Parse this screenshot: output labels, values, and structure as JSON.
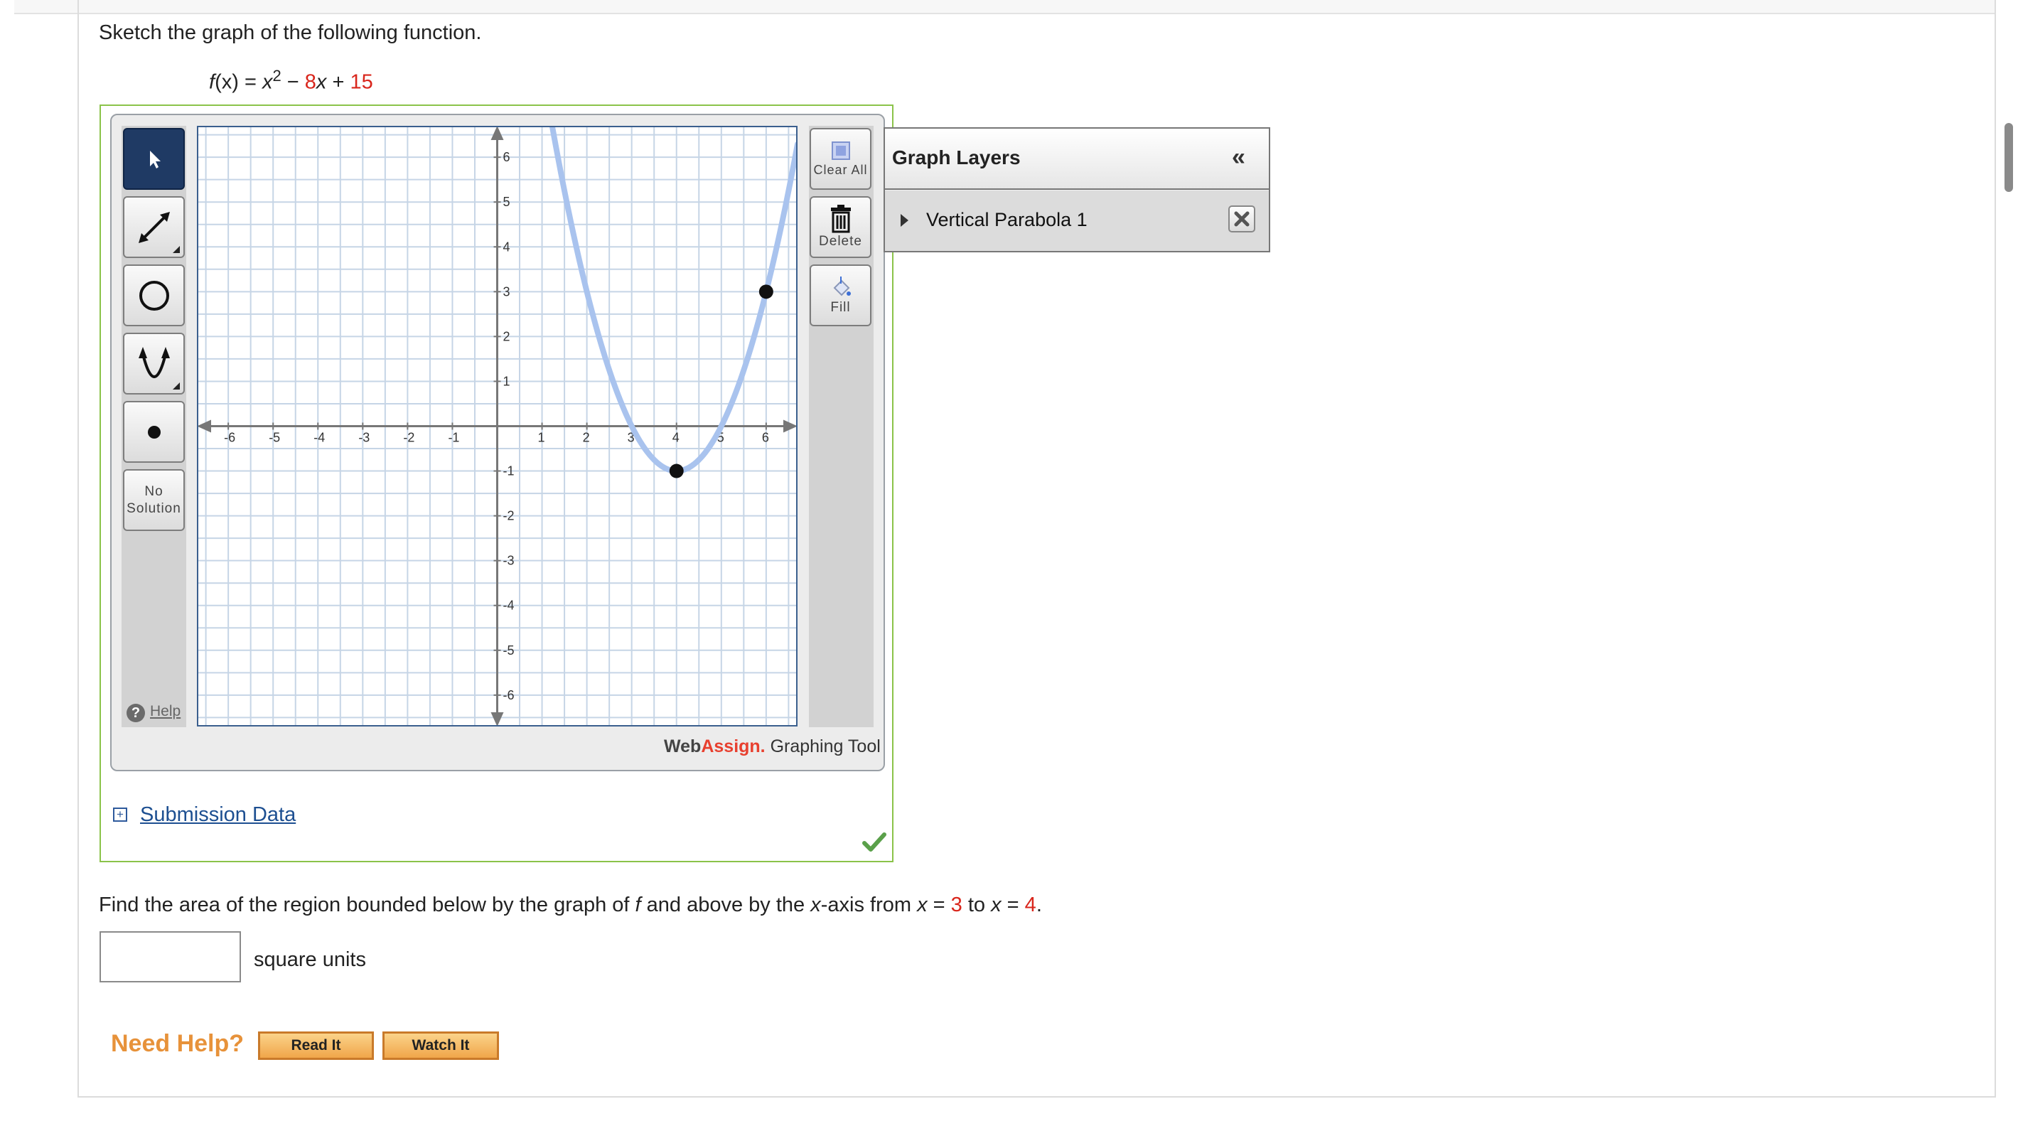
{
  "question": {
    "prompt": "Sketch the graph of the following function.",
    "function": {
      "lhs": "f",
      "lhs_arg": "(x)",
      "eq": " = ",
      "x": "x",
      "exp": "2",
      "minus": " − ",
      "b": "8",
      "bx": "x",
      "plus": " + ",
      "c": "15"
    },
    "part2": {
      "t1": "Find the area of the region bounded below by the graph of ",
      "f": "f",
      "t2": " and above by the ",
      "x1": "x",
      "t3": "-axis from ",
      "x2": "x",
      "t4": " = ",
      "a": "3",
      "t5": " to ",
      "x3": "x",
      "t6": " = ",
      "b": "4",
      "t7": "."
    },
    "answer_value": "",
    "units": "square units"
  },
  "toolbar": {
    "left_tools": [
      {
        "name": "pointer",
        "icon": "pointer-icon",
        "active": true
      },
      {
        "name": "line",
        "icon": "line-icon"
      },
      {
        "name": "circle",
        "icon": "circle-icon"
      },
      {
        "name": "parabola",
        "icon": "parabola-icon"
      },
      {
        "name": "point",
        "icon": "point-icon"
      }
    ],
    "no_solution_line1": "No",
    "no_solution_line2": "Solution",
    "help_label": "Help",
    "clear_all_label": "Clear All",
    "delete_label": "Delete",
    "fill_label": "Fill"
  },
  "brand": {
    "web": "Web",
    "assign": "Assign.",
    "tool": " Graphing Tool"
  },
  "graph_layers": {
    "title": "Graph Layers",
    "collapse_label": "«",
    "items": [
      {
        "label": "Vertical Parabola 1"
      }
    ]
  },
  "submission_data_label": "Submission Data",
  "need_help": {
    "label": "Need Help?",
    "read_it": "Read It",
    "watch_it": "Watch It"
  },
  "chart_data": {
    "type": "line",
    "xlim": [
      -6.7,
      6.7
    ],
    "ylim": [
      -6.7,
      6.7
    ],
    "x_ticks": [
      -6,
      -5,
      -4,
      -3,
      -2,
      -1,
      1,
      2,
      3,
      4,
      5,
      6
    ],
    "y_ticks": [
      6,
      5,
      4,
      3,
      2,
      1,
      -1,
      -2,
      -3,
      -4,
      -5,
      -6
    ],
    "grid": true,
    "curve": {
      "a": 1,
      "b": -8,
      "c": 15
    },
    "points": [
      {
        "x": 4,
        "y": -1
      },
      {
        "x": 6,
        "y": 3
      }
    ],
    "colors": {
      "grid": "#c6d5e6",
      "axis": "#777777",
      "curve": "#a9c3ee",
      "point": "#111111",
      "border": "#3b5f8e"
    }
  }
}
